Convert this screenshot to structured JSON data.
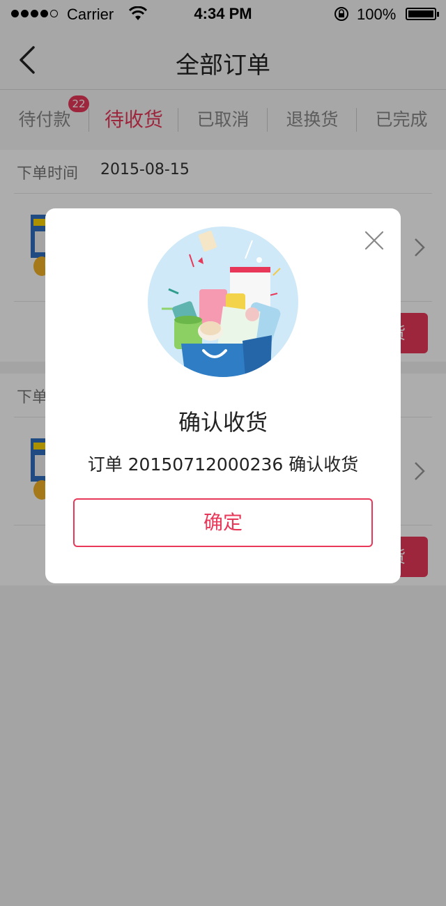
{
  "status_bar": {
    "carrier": "Carrier",
    "time": "4:34 PM",
    "battery": "100%",
    "icons": [
      "signal-dots",
      "wifi-icon",
      "rotation-lock-icon",
      "battery-icon"
    ]
  },
  "nav": {
    "title": "全部订单",
    "back_icon": "chevron-left-icon"
  },
  "tabs": [
    {
      "label": "待付款",
      "badge": "22"
    },
    {
      "label": "待收货",
      "active": true
    },
    {
      "label": "已取消"
    },
    {
      "label": "退换货"
    },
    {
      "label": "已完成"
    }
  ],
  "orders": [
    {
      "time_label": "下单时间",
      "time_value": "2015-08-15",
      "action_label": "确认收货"
    },
    {
      "time_label": "下单时间",
      "time_value": "",
      "action_label": "确认收货"
    }
  ],
  "modal": {
    "title": "确认收货",
    "message": "订单 20150712000236 确认收货",
    "ok_label": "确定",
    "close_icon": "close-icon",
    "illustration": "shopping-bag-illustration"
  },
  "colors": {
    "accent": "#e8385a",
    "overlay": "rgba(0,0,0,0.32)"
  }
}
